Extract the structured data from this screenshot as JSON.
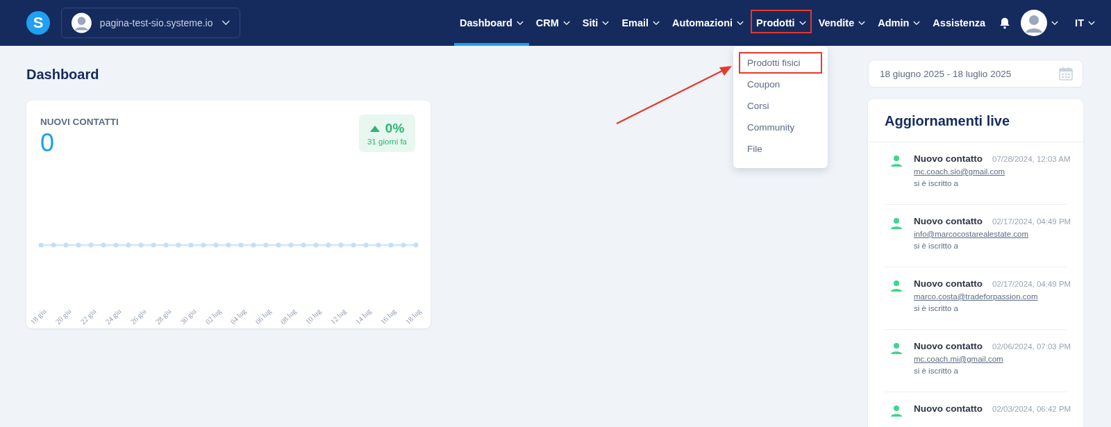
{
  "header": {
    "logo": "S",
    "workspace": "pagina-test-sio.systeme.io",
    "nav": [
      {
        "label": "Dashboard",
        "kind": "menu",
        "selected": true,
        "highlighted": false
      },
      {
        "label": "CRM",
        "kind": "menu",
        "selected": false,
        "highlighted": false
      },
      {
        "label": "Siti",
        "kind": "menu",
        "selected": false,
        "highlighted": false
      },
      {
        "label": "Email",
        "kind": "menu",
        "selected": false,
        "highlighted": false
      },
      {
        "label": "Automazioni",
        "kind": "menu",
        "selected": false,
        "highlighted": false
      },
      {
        "label": "Prodotti",
        "kind": "menu",
        "selected": false,
        "highlighted": true
      },
      {
        "label": "Vendite",
        "kind": "menu",
        "selected": false,
        "highlighted": false
      },
      {
        "label": "Admin",
        "kind": "menu",
        "selected": false,
        "highlighted": false
      },
      {
        "label": "Assistenza",
        "kind": "link",
        "selected": false,
        "highlighted": false
      }
    ],
    "language": "IT"
  },
  "dropdown": {
    "items": [
      {
        "label": "Prodotti fisici",
        "highlighted": true
      },
      {
        "label": "Coupon",
        "highlighted": false
      },
      {
        "label": "Corsi",
        "highlighted": false
      },
      {
        "label": "Community",
        "highlighted": false
      },
      {
        "label": "File",
        "highlighted": false
      }
    ]
  },
  "page_title": "Dashboard",
  "contacts_card": {
    "title": "NUOVI CONTATTI",
    "value": "0",
    "change": "0%",
    "change_period": "31 giorni fa",
    "chart": {
      "x_labels": [
        "18 giu",
        "20 giu",
        "22 giu",
        "24 giu",
        "26 giu",
        "28 giu",
        "30 giu",
        "02 lug",
        "04 lug",
        "06 lug",
        "08 lug",
        "10 lug",
        "12 lug",
        "14 lug",
        "16 lug",
        "18 lug"
      ]
    }
  },
  "date_range": "18 giugno 2025 - 18 luglio 2025",
  "live_updates": {
    "title": "Aggiornamenti live",
    "entries": [
      {
        "title": "Nuovo contatto",
        "time": "07/28/2024, 12:03 AM",
        "email": "mc.coach.sio@gmail.com",
        "text": "si è iscritto a"
      },
      {
        "title": "Nuovo contatto",
        "time": "02/17/2024, 04:49 PM",
        "email": "info@marcocostarealestate.com",
        "text": "si è iscritto a"
      },
      {
        "title": "Nuovo contatto",
        "time": "02/17/2024, 04:49 PM",
        "email": "marco.costa@tradeforpassion.com",
        "text": "si è iscritto a"
      },
      {
        "title": "Nuovo contatto",
        "time": "02/06/2024, 07:03 PM",
        "email": "mc.coach.mi@gmail.com",
        "text": "si è iscritto a"
      },
      {
        "title": "Nuovo contatto",
        "time": "02/03/2024, 06:42 PM"
      }
    ]
  }
}
